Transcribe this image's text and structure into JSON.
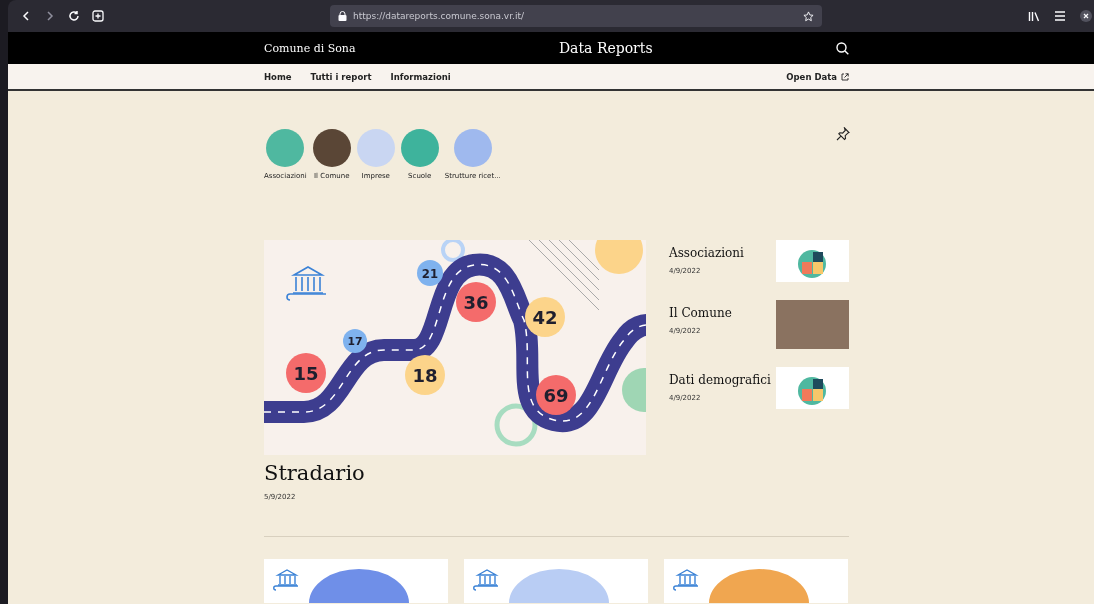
{
  "browser": {
    "url": "https://datareports.comune.sona.vr.it/"
  },
  "header": {
    "site_name": "Comune di Sona",
    "title": "Data Reports"
  },
  "nav": {
    "items": [
      {
        "label": "Home"
      },
      {
        "label": "Tutti i report"
      },
      {
        "label": "Informazioni"
      }
    ],
    "open_data": "Open Data"
  },
  "categories": [
    {
      "label": "Associazioni",
      "color": "#4fb8a0"
    },
    {
      "label": "Il Comune",
      "color": "#5a4636"
    },
    {
      "label": "Imprese",
      "color": "#c9d6f2"
    },
    {
      "label": "Scuole",
      "color": "#3eb39c"
    },
    {
      "label": "Strutture ricet...",
      "color": "#9fb9ee"
    }
  ],
  "featured": {
    "title": "Stradario",
    "date": "5/9/2022",
    "markers": [
      {
        "label": "15",
        "color": "#f46b6b"
      },
      {
        "label": "17",
        "color": "#7fb2ee"
      },
      {
        "label": "18",
        "color": "#fcd48a"
      },
      {
        "label": "21",
        "color": "#7fb2ee"
      },
      {
        "label": "36",
        "color": "#f46b6b"
      },
      {
        "label": "42",
        "color": "#fcd48a"
      },
      {
        "label": "69",
        "color": "#f46b6b"
      }
    ]
  },
  "side_reports": [
    {
      "title": "Associazioni",
      "date": "4/9/2022",
      "kind": "illustration"
    },
    {
      "title": "Il Comune",
      "date": "4/9/2022",
      "kind": "photo"
    },
    {
      "title": "Dati demografici",
      "date": "4/9/2022",
      "kind": "illustration"
    }
  ],
  "cards": [
    {
      "color": "#6f8fe8"
    },
    {
      "color": "#b9cdf4"
    },
    {
      "color": "#f0a650"
    }
  ]
}
